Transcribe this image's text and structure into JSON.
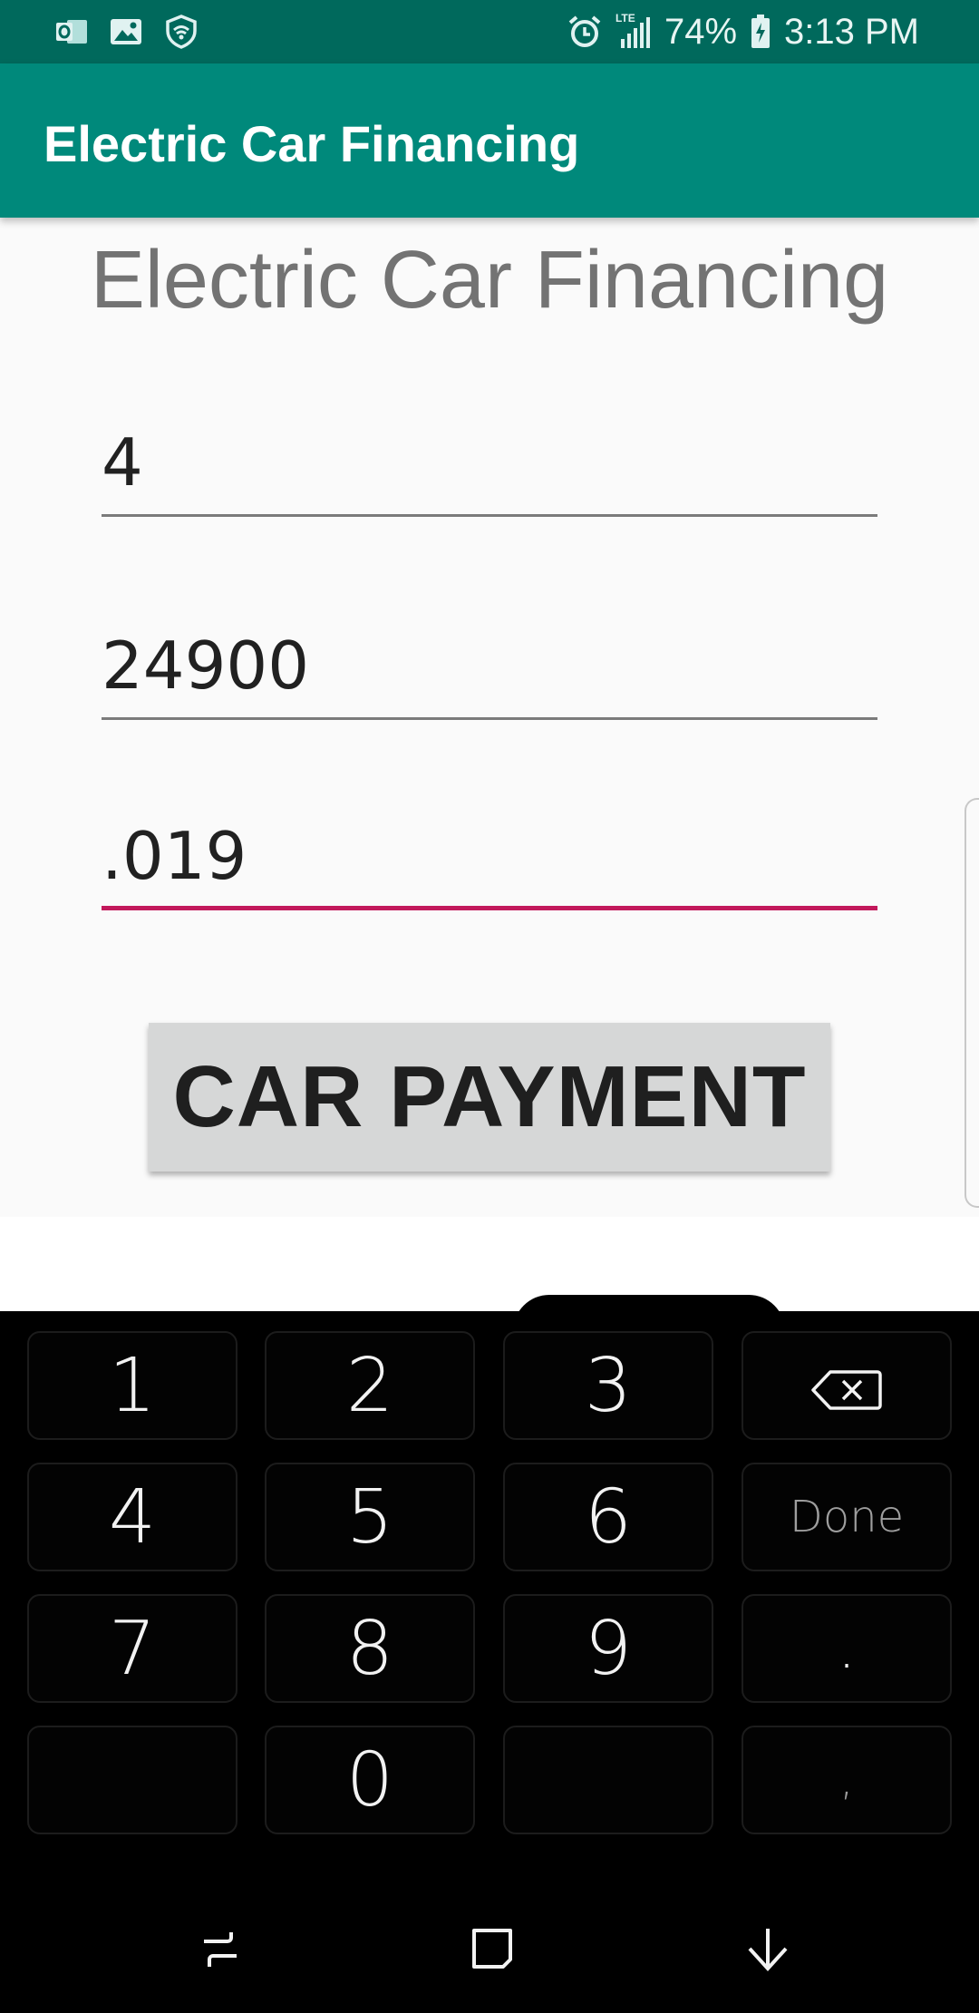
{
  "status_bar": {
    "battery": "74%",
    "time": "3:13 PM",
    "network": "LTE",
    "icons_left": [
      "outlook-icon",
      "image-icon",
      "wifi-shield-icon"
    ],
    "icons_right": [
      "alarm-icon",
      "signal-icon",
      "battery-icon"
    ]
  },
  "app_bar": {
    "title": "Electric Car Financing",
    "color": "#00897b"
  },
  "main": {
    "heading": "Electric Car Financing",
    "fields": [
      {
        "name": "years",
        "value": "4"
      },
      {
        "name": "loan-amount",
        "value": "24900"
      },
      {
        "name": "interest-rate",
        "value": ".019",
        "focused": true
      }
    ],
    "button_label": "CAR PAYMENT",
    "focus_color": "#c2185b"
  },
  "keyboard": {
    "keys": [
      [
        "1",
        "2",
        "3",
        "backspace-icon"
      ],
      [
        "4",
        "5",
        "6",
        "Done"
      ],
      [
        "7",
        "8",
        "9",
        "."
      ],
      [
        "",
        "0",
        "",
        ","
      ]
    ],
    "labels": {
      "k1": "1",
      "k2": "2",
      "k3": "3",
      "k4": "4",
      "k5": "5",
      "k6": "6",
      "done": "Done",
      "k7": "7",
      "k8": "8",
      "k9": "9",
      "dot": ".",
      "k0": "0",
      "comma": ","
    }
  },
  "nav_bar": {
    "buttons": [
      "recent-apps-icon",
      "home-icon",
      "back-icon"
    ]
  }
}
